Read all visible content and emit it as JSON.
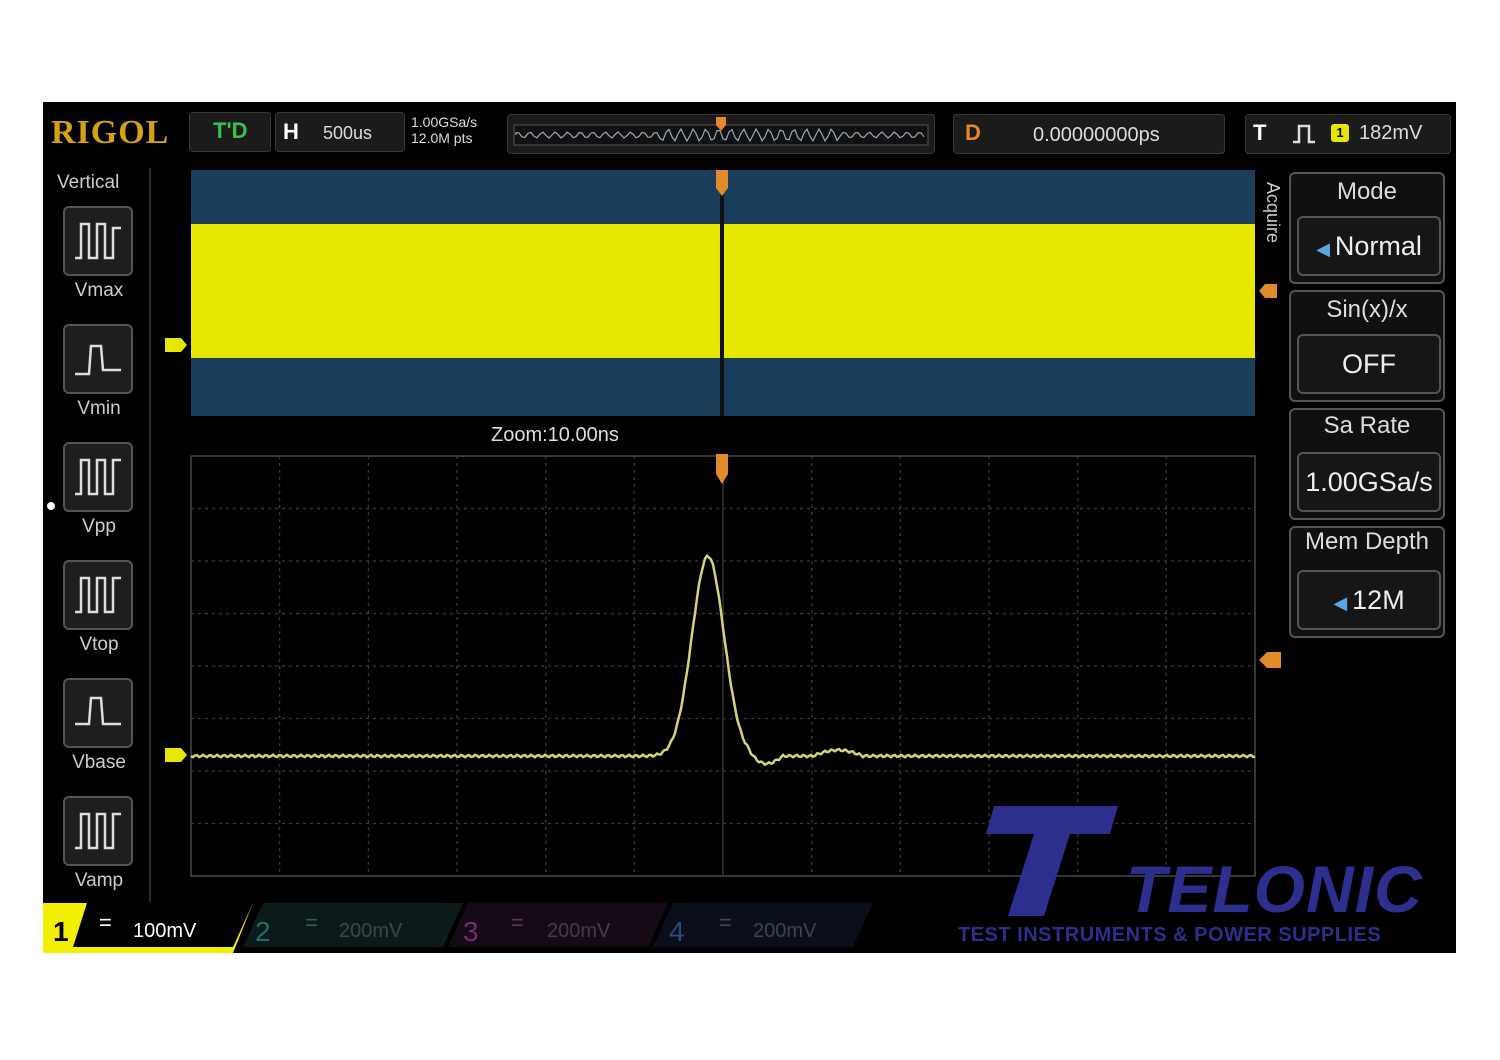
{
  "brand": "RIGOL",
  "status": "T'D",
  "horizontal": {
    "label": "H",
    "timebase": "500us",
    "sample_rate": "1.00GSa/s",
    "memory": "12.0M pts"
  },
  "delay": {
    "label": "D",
    "value": "0.00000000ps"
  },
  "trigger": {
    "label": "T",
    "source": "1",
    "level": "182mV"
  },
  "vertical_menu": {
    "title": "Vertical",
    "items": [
      {
        "label": "Vmax"
      },
      {
        "label": "Vmin"
      },
      {
        "label": "Vpp"
      },
      {
        "label": "Vtop"
      },
      {
        "label": "Vbase"
      },
      {
        "label": "Vamp"
      }
    ]
  },
  "acquire_menu": {
    "title": "Acquire",
    "items": [
      {
        "label": "Mode",
        "value": "Normal"
      },
      {
        "label": "Sin(x)/x",
        "value": "OFF"
      },
      {
        "label": "Sa Rate",
        "value": "1.00GSa/s"
      },
      {
        "label": "Mem Depth",
        "value": "12M"
      }
    ]
  },
  "zoom": {
    "label": "Zoom:10.00ns"
  },
  "channels": [
    {
      "num": "1",
      "coupling": "=",
      "scale": "100mV",
      "color": "#f0f000"
    },
    {
      "num": "2",
      "coupling": "=",
      "scale": "200mV",
      "color": "#1f6f66"
    },
    {
      "num": "3",
      "coupling": "=",
      "scale": "200mV",
      "color": "#7a2a78"
    },
    {
      "num": "4",
      "coupling": "=",
      "scale": "200mV",
      "color": "#2a4a7a"
    }
  ],
  "watermark": {
    "name": "TELONIC",
    "tagline": "TEST INSTRUMENTS & POWER SUPPLIES"
  },
  "colors": {
    "trace": "#e6e600",
    "main_bg": "#1a3d5c",
    "trigger_marker": "#e08a2a",
    "accent_blue": "#2d2f8f"
  }
}
